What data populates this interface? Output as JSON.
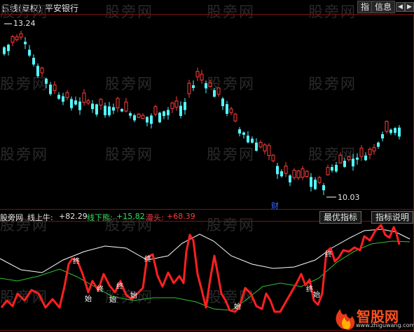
{
  "header": {
    "period_label": "日线(复权)",
    "stock_name": "平安银行",
    "btn_zhi": "指",
    "btn_info": "信息",
    "nav_left": "◀",
    "nav_right": "▶"
  },
  "price_panel": {
    "high_label": "13.24",
    "low_label": "10.03",
    "event_marker": "财"
  },
  "indicator_panel": {
    "name": "股旁网",
    "line_up_label": "线上牛:",
    "line_up_value": "+82.29",
    "line_down_label": "线下熊:",
    "line_down_value": "+15.82",
    "head_label": "滑头:",
    "head_value": "+68.39",
    "btn_best": "最优指标",
    "btn_explain": "指标说明",
    "signals": [
      "终",
      "终",
      "始",
      "终",
      "始",
      "终",
      "始",
      "始",
      "终",
      "始",
      "终"
    ]
  },
  "watermark": {
    "text": "股旁网",
    "brand_text": "智股网",
    "brand_url": "www.zhiguwang.com"
  },
  "colors": {
    "background": "#000000",
    "up_candle": "#ff3c3c",
    "down_candle": "#54f7ff",
    "line_up": "#ffffff",
    "line_down": "#2fc42f",
    "head_line": "#ff2020",
    "grid_red": "#7a1212",
    "label_green": "#2fe05a",
    "label_red": "#ff3c3c"
  }
}
